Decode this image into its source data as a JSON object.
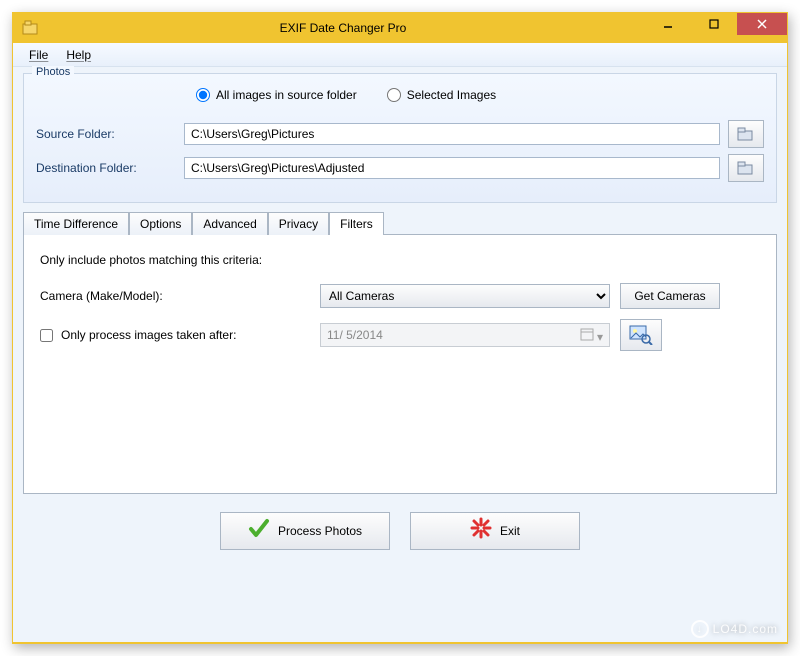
{
  "window": {
    "title": "EXIF Date Changer Pro"
  },
  "menu": {
    "file": "File",
    "help": "Help"
  },
  "photos": {
    "group_title": "Photos",
    "radio_all": "All images in source folder",
    "radio_selected": "Selected Images",
    "source_label": "Source Folder:",
    "source_value": "C:\\Users\\Greg\\Pictures",
    "dest_label": "Destination Folder:",
    "dest_value": "C:\\Users\\Greg\\Pictures\\Adjusted"
  },
  "tabs": {
    "time": "Time Difference",
    "options": "Options",
    "advanced": "Advanced",
    "privacy": "Privacy",
    "filters": "Filters"
  },
  "filters": {
    "criteria_text": "Only include photos matching this criteria:",
    "camera_label": "Camera (Make/Model):",
    "camera_value": "All Cameras",
    "get_cameras": "Get Cameras",
    "only_after": "Only process images taken after:",
    "date_value": "11/ 5/2014"
  },
  "buttons": {
    "process": "Process Photos",
    "exit": "Exit"
  },
  "watermark": "LO4D.com"
}
